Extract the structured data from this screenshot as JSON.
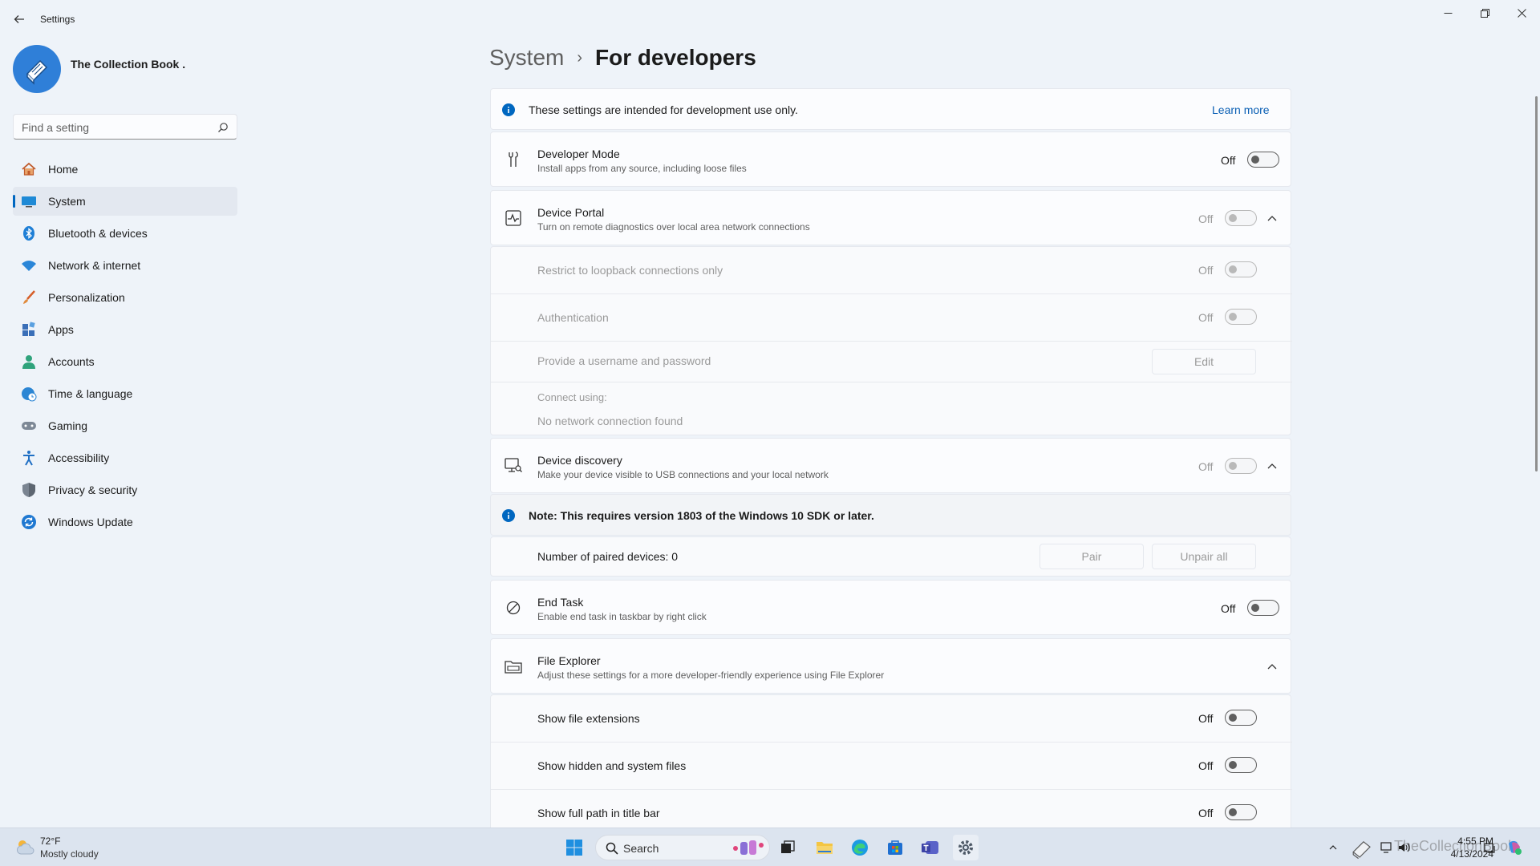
{
  "window": {
    "title": "Settings"
  },
  "profile": {
    "name": "The Collection Book ."
  },
  "search": {
    "placeholder": "Find a setting"
  },
  "nav": {
    "items": [
      {
        "label": "Home"
      },
      {
        "label": "System"
      },
      {
        "label": "Bluetooth & devices"
      },
      {
        "label": "Network & internet"
      },
      {
        "label": "Personalization"
      },
      {
        "label": "Apps"
      },
      {
        "label": "Accounts"
      },
      {
        "label": "Time & language"
      },
      {
        "label": "Gaming"
      },
      {
        "label": "Accessibility"
      },
      {
        "label": "Privacy & security"
      },
      {
        "label": "Windows Update"
      }
    ]
  },
  "breadcrumb": {
    "parent": "System",
    "current": "For developers"
  },
  "info": {
    "text": "These settings are intended for development use only.",
    "link": "Learn more"
  },
  "developer_mode": {
    "title": "Developer Mode",
    "desc": "Install apps from any source, including loose files",
    "state": "Off"
  },
  "device_portal": {
    "title": "Device Portal",
    "desc": "Turn on remote diagnostics over local area network connections",
    "state": "Off",
    "loopback": {
      "title": "Restrict to loopback connections only",
      "state": "Off"
    },
    "auth": {
      "title": "Authentication",
      "state": "Off"
    },
    "credentials": {
      "title": "Provide a username and password",
      "button": "Edit"
    },
    "connect": {
      "title": "Connect using:",
      "value": "No network connection found"
    }
  },
  "device_discovery": {
    "title": "Device discovery",
    "desc": "Make your device visible to USB connections and your local network",
    "state": "Off",
    "note": "Note: This requires version 1803 of the Windows 10 SDK or later.",
    "paired": {
      "title": "Number of paired devices: 0",
      "pair_button": "Pair",
      "unpair_button": "Unpair all"
    }
  },
  "end_task": {
    "title": "End Task",
    "desc": "Enable end task in taskbar by right click",
    "state": "Off"
  },
  "file_explorer": {
    "title": "File Explorer",
    "desc": "Adjust these settings for a more developer-friendly experience using File Explorer",
    "extensions": {
      "title": "Show file extensions",
      "state": "Off"
    },
    "hidden": {
      "title": "Show hidden and system files",
      "state": "Off"
    },
    "fullpath": {
      "title": "Show full path in title bar",
      "state": "Off"
    }
  },
  "taskbar": {
    "weather_temp": "72°F",
    "weather_desc": "Mostly cloudy",
    "search_label": "Search",
    "time": "4:55 PM",
    "date": "4/13/2024",
    "watermark": "TheCollectionBook"
  },
  "colors": {
    "accent": "#0067c0",
    "background": "#eef3f9",
    "card": "#fbfcfe"
  }
}
